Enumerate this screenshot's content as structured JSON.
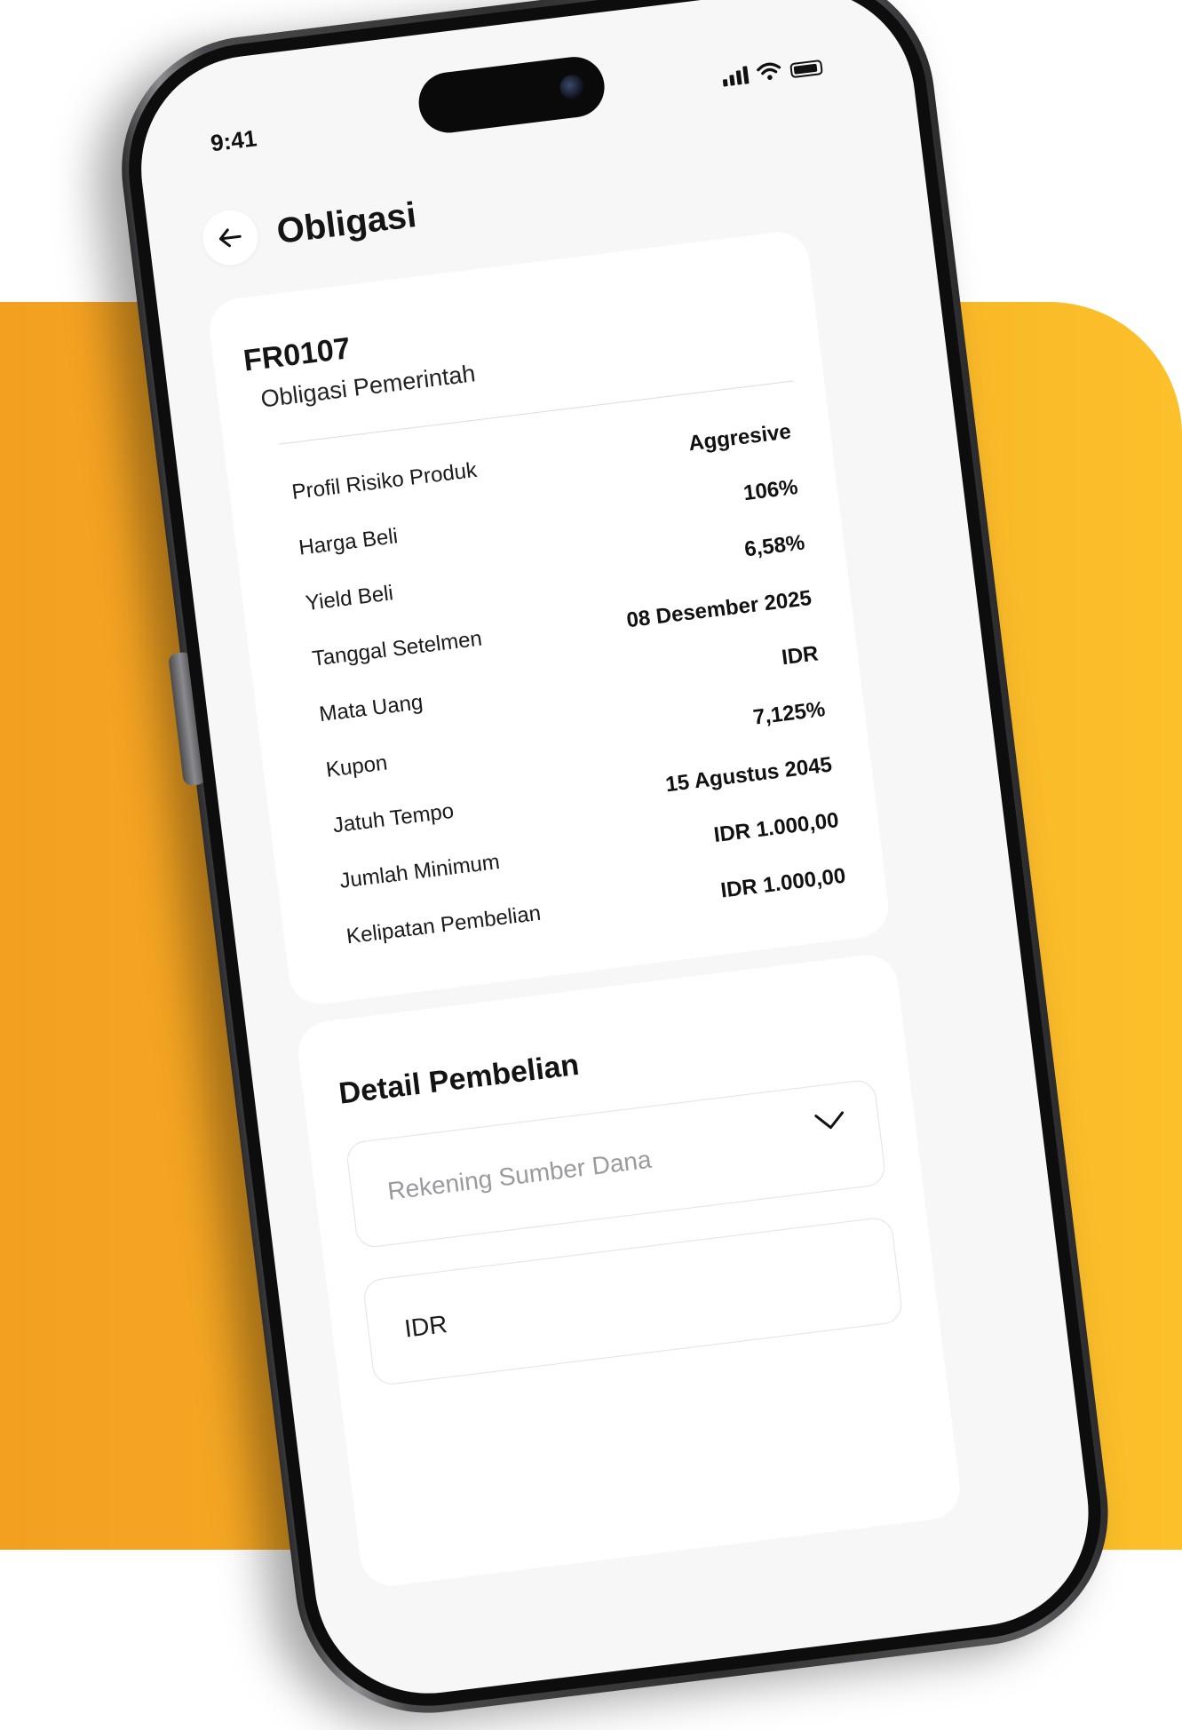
{
  "status_bar": {
    "time": "9:41"
  },
  "header": {
    "title": "Obligasi"
  },
  "bond": {
    "code": "FR0107",
    "type": "Obligasi Pemerintah",
    "details": [
      {
        "label": "Profil Risiko Produk",
        "value": "Aggresive"
      },
      {
        "label": "Harga Beli",
        "value": "106%"
      },
      {
        "label": "Yield Beli",
        "value": "6,58%"
      },
      {
        "label": "Tanggal Setelmen",
        "value": "08 Desember 2025"
      },
      {
        "label": "Mata Uang",
        "value": "IDR"
      },
      {
        "label": "Kupon",
        "value": "7,125%"
      },
      {
        "label": "Jatuh Tempo",
        "value": "15 Agustus 2045"
      },
      {
        "label": "Jumlah Minimum",
        "value": "IDR 1.000,00"
      },
      {
        "label": "Kelipatan Pembelian",
        "value": "IDR 1.000,00"
      }
    ]
  },
  "purchase": {
    "title": "Detail Pembelian",
    "source_account_placeholder": "Rekening Sumber Dana",
    "currency_value": "IDR"
  },
  "colors": {
    "accent_orange": "#f3a021",
    "accent_yellow": "#fcc02a",
    "screen_bg": "#f7f7f8",
    "card_bg": "#ffffff"
  }
}
